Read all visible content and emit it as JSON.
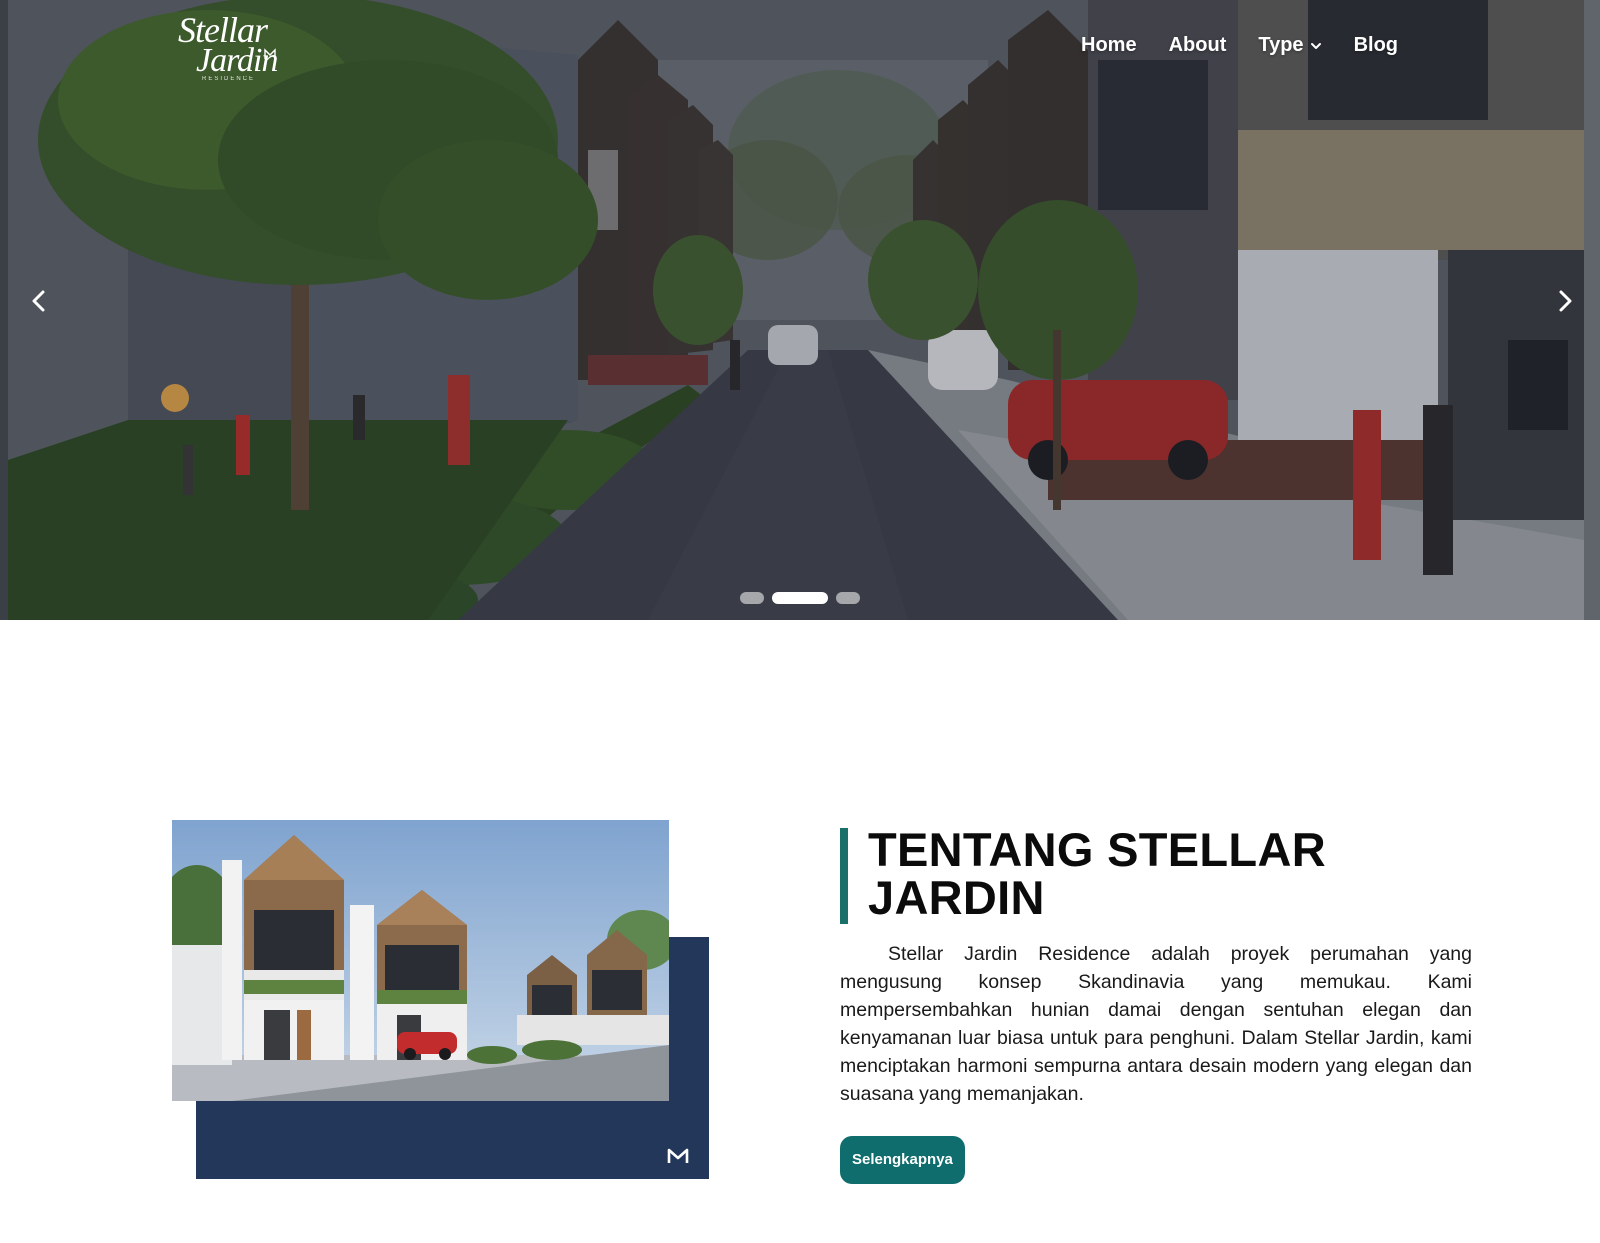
{
  "brand": {
    "logo_line1": "Stellar",
    "logo_line2": "Jardin",
    "logo_sub": "RESIDENCE"
  },
  "nav": {
    "items": [
      {
        "label": "Home"
      },
      {
        "label": "About"
      },
      {
        "label": "Type",
        "has_dropdown": true
      },
      {
        "label": "Blog"
      }
    ]
  },
  "carousel": {
    "slide_count": 3,
    "active_index": 1,
    "prev_icon": "chevron-left-icon",
    "next_icon": "chevron-right-icon"
  },
  "about": {
    "title": "TENTANG STELLAR JARDIN",
    "body": "Stellar Jardin Residence adalah proyek perumahan yang mengusung konsep Skandinavia yang memukau. Kami mempersembahkan hunian damai dengan sentuhan elegan dan kenyamanan luar biasa untuk para penghuni. Dalam Stellar Jardin, kami menciptakan harmoni sempurna antara desain modern yang elegan dan suasana yang memanjakan.",
    "button_label": "Selengkapnya"
  },
  "colors": {
    "accent_teal": "#0f6e6d",
    "navy_block": "#23375a",
    "hero_overlay": "#2a2f38"
  }
}
